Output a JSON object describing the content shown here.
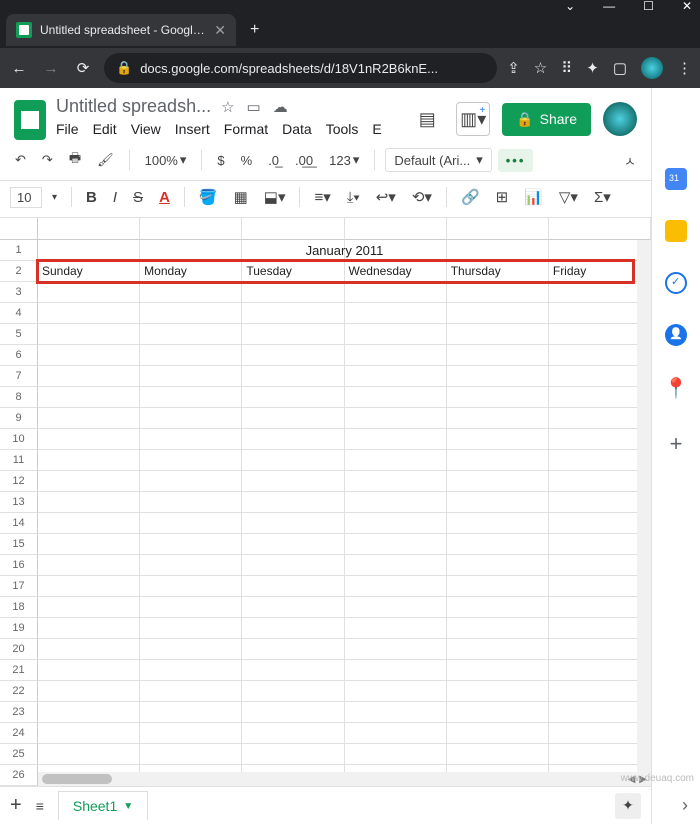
{
  "browser": {
    "tab_title": "Untitled spreadsheet - Google Sh",
    "url_host": "docs.google.com",
    "url_path": "/spreadsheets/d/18V1nR2B6knE..."
  },
  "header": {
    "doc_title": "Untitled spreadsh...",
    "menus": [
      "File",
      "Edit",
      "View",
      "Insert",
      "Format",
      "Data",
      "Tools",
      "E"
    ],
    "share_label": "Share"
  },
  "toolbar": {
    "zoom": "100%",
    "currency": "$",
    "percent": "%",
    "dec_less": ".0",
    "dec_more": ".00",
    "num_format": "123",
    "font": "Default (Ari...",
    "font_size": "10"
  },
  "grid": {
    "title_cell": "January 2011",
    "day_headers": [
      "Sunday",
      "Monday",
      "Tuesday",
      "Wednesday",
      "Thursday",
      "Friday"
    ],
    "row_count": 26,
    "col_labels": []
  },
  "bottom": {
    "sheet_name": "Sheet1"
  },
  "watermark": "www.deuaq.com"
}
